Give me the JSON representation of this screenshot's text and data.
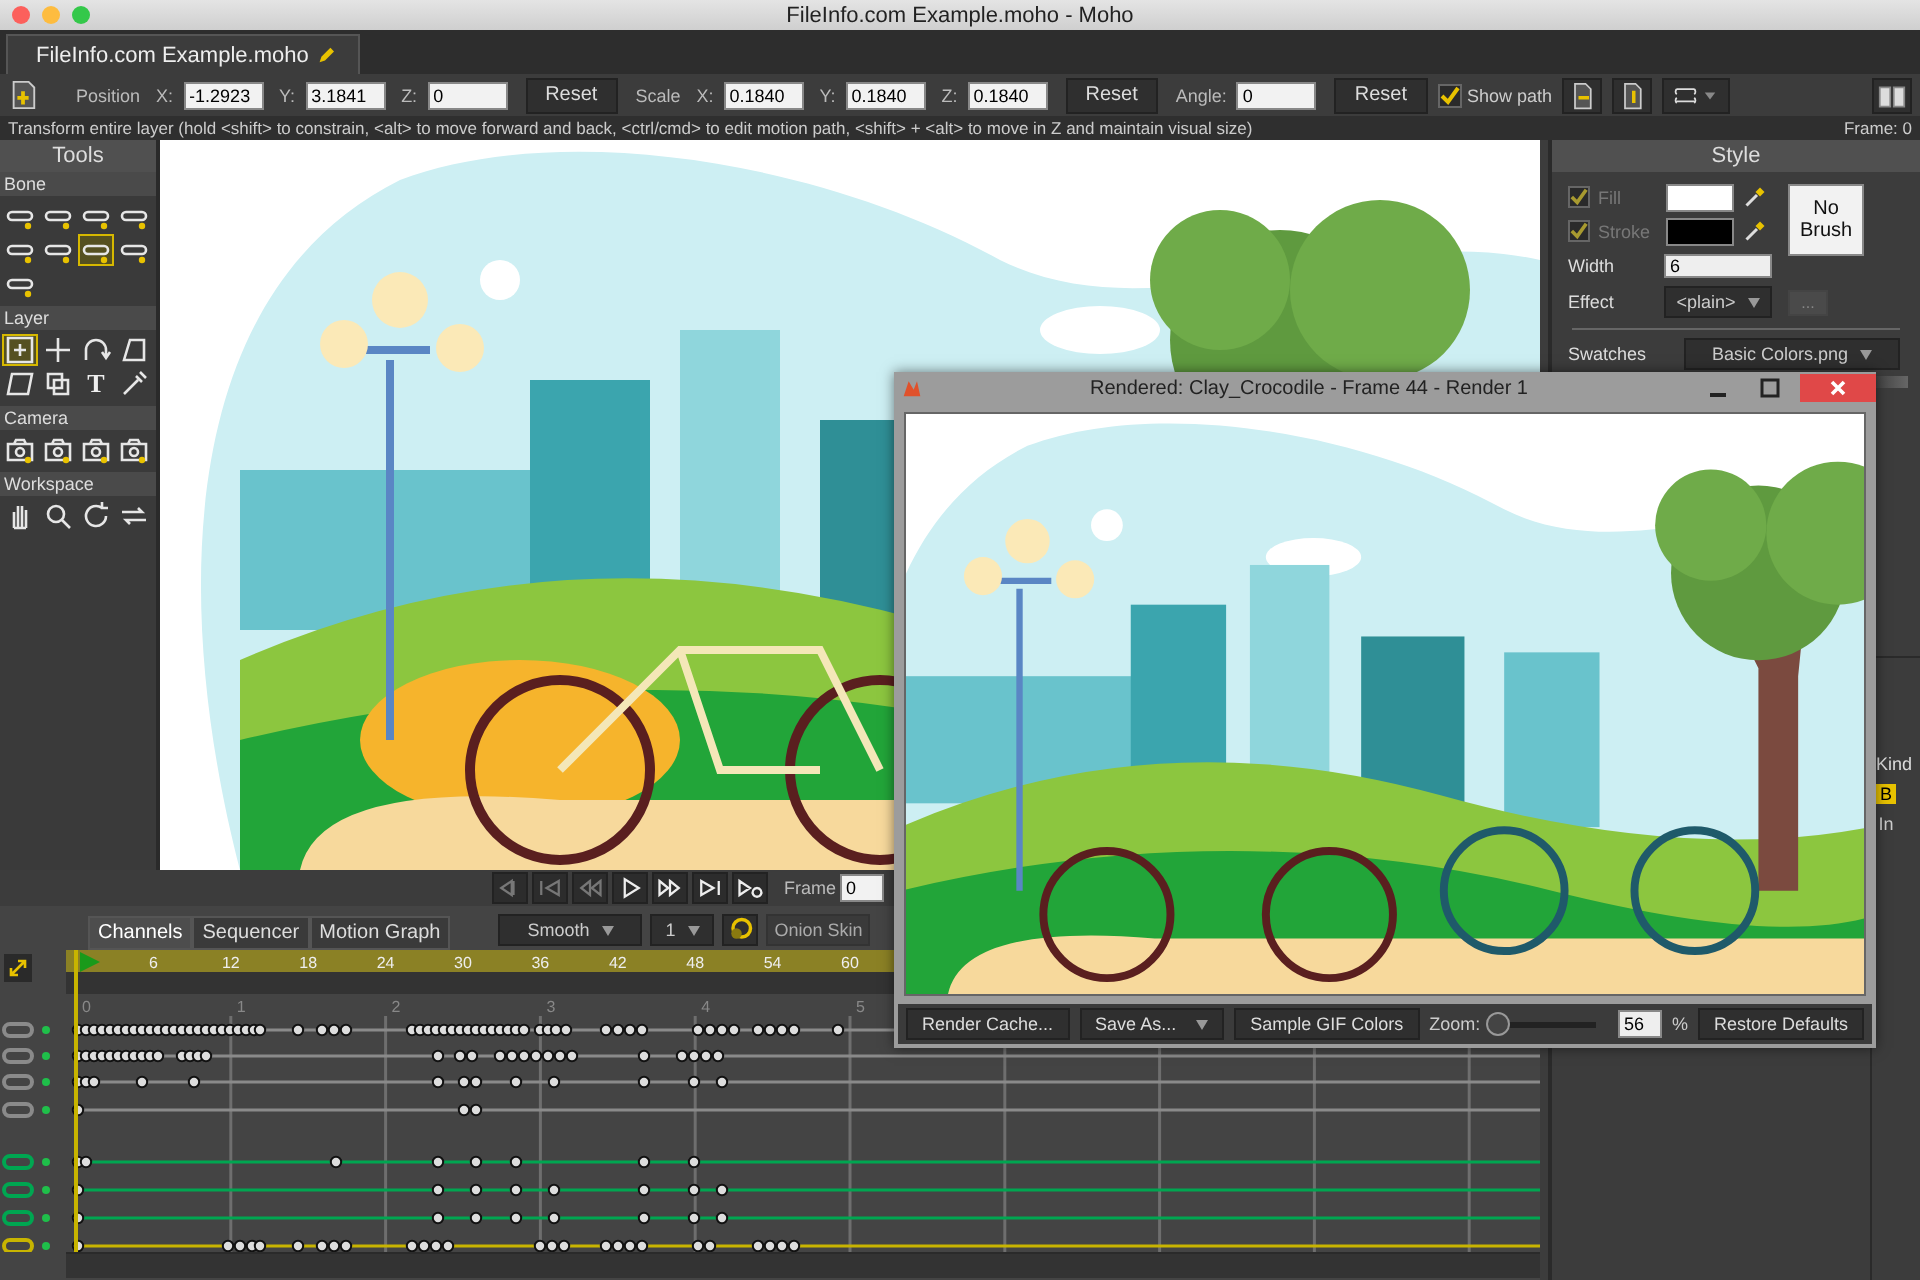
{
  "window": {
    "title": "FileInfo.com Example.moho - Moho"
  },
  "document_tab": {
    "label": "FileInfo.com Example.moho",
    "selected": true
  },
  "toolbar": {
    "items": [
      {
        "kind": "label",
        "text": "Position"
      },
      {
        "kind": "axis",
        "text": "X:"
      },
      {
        "kind": "field",
        "value": "-1.2923"
      },
      {
        "kind": "axis",
        "text": "Y:"
      },
      {
        "kind": "field",
        "value": "3.1841"
      },
      {
        "kind": "axis",
        "text": "Z:"
      },
      {
        "kind": "field",
        "value": "0"
      },
      {
        "kind": "button",
        "text": "Reset"
      },
      {
        "kind": "label",
        "text": "Scale"
      },
      {
        "kind": "axis",
        "text": "X:"
      },
      {
        "kind": "field",
        "value": "0.1840"
      },
      {
        "kind": "axis",
        "text": "Y:"
      },
      {
        "kind": "field",
        "value": "0.1840"
      },
      {
        "kind": "axis",
        "text": "Z:"
      },
      {
        "kind": "field",
        "value": "0.1840"
      },
      {
        "kind": "button",
        "text": "Reset"
      },
      {
        "kind": "label",
        "text": "Angle:"
      },
      {
        "kind": "field",
        "value": "0"
      },
      {
        "kind": "button",
        "text": "Reset"
      },
      {
        "kind": "checkbox",
        "text": "Show path",
        "checked": true
      }
    ]
  },
  "hint": "Transform entire layer (hold <shift> to constrain, <alt> to move forward and back, <ctrl/cmd> to edit motion path, <shift> + <alt> to move in Z and maintain visual size)",
  "frame_readout": "Frame: 0",
  "tools": {
    "title": "Tools",
    "sections": [
      {
        "title": "Bone",
        "kind": "bone",
        "tools": [
          {
            "selected": false
          },
          {
            "selected": false
          },
          {
            "selected": false
          },
          {
            "selected": false
          },
          {
            "selected": false
          },
          {
            "selected": false
          },
          {
            "selected": true
          },
          {
            "selected": false
          },
          {
            "selected": false
          }
        ]
      },
      {
        "title": "Layer",
        "kind": "layer",
        "tools": [
          {
            "selected": true
          },
          {
            "selected": false
          },
          {
            "selected": false
          },
          {
            "selected": false
          },
          {
            "selected": false
          },
          {
            "selected": false
          },
          {
            "selected": false,
            "glyph": "T"
          },
          {
            "selected": false
          }
        ]
      },
      {
        "title": "Camera",
        "kind": "camera",
        "tools": [
          {
            "selected": false
          },
          {
            "selected": false
          },
          {
            "selected": false
          },
          {
            "selected": false
          }
        ]
      },
      {
        "title": "Workspace",
        "kind": "workspace",
        "tools": [
          {
            "selected": false
          },
          {
            "selected": false
          },
          {
            "selected": false
          },
          {
            "selected": false
          }
        ]
      }
    ]
  },
  "style_panel": {
    "title": "Style",
    "fill": {
      "label": "Fill",
      "checked": true,
      "disabled": true,
      "color": "#ffffff"
    },
    "stroke": {
      "label": "Stroke",
      "checked": true,
      "disabled": true,
      "color": "#000000"
    },
    "width": {
      "label": "Width",
      "value": "6"
    },
    "effect": {
      "label": "Effect",
      "value": "<plain>"
    },
    "more_button": "...",
    "brush_button": "No Brush",
    "swatches": {
      "label": "Swatches",
      "value": "Basic Colors.png"
    }
  },
  "layers_column": {
    "header": "Kind",
    "items": [
      "B",
      "In"
    ]
  },
  "playback": {
    "frame_label": "Frame",
    "frame_value": "0"
  },
  "timeline": {
    "tabs": [
      {
        "label": "Channels",
        "selected": true
      },
      {
        "label": "Sequencer",
        "selected": false
      },
      {
        "label": "Motion Graph",
        "selected": false
      }
    ],
    "interpolation": "Smooth",
    "step": "1",
    "onion_label": "Onion Skin",
    "frame_ticks": [
      "6",
      "12",
      "18",
      "24",
      "30",
      "36",
      "42",
      "48",
      "54",
      "60"
    ],
    "second_ticks": [
      "0",
      "1",
      "2",
      "3",
      "4",
      "5"
    ],
    "channels": [
      {
        "color": "#8a8a8a"
      },
      {
        "color": "#8a8a8a"
      },
      {
        "color": "#8a8a8a"
      },
      {
        "color": "#8a8a8a"
      },
      {
        "color": "#00a651"
      },
      {
        "color": "#00a651"
      },
      {
        "color": "#00a651"
      },
      {
        "color": "#c8b400"
      }
    ]
  },
  "render_window": {
    "title": "Rendered: Clay_Crocodile - Frame 44 - Render 1",
    "render_cache_button": "Render Cache...",
    "save_button": "Save As...",
    "sample_button": "Sample GIF Colors",
    "zoom_label": "Zoom:",
    "zoom": {
      "level": 0.08
    },
    "zoom_value": "56",
    "zoom_unit": "%",
    "restore_button": "Restore Defaults"
  }
}
